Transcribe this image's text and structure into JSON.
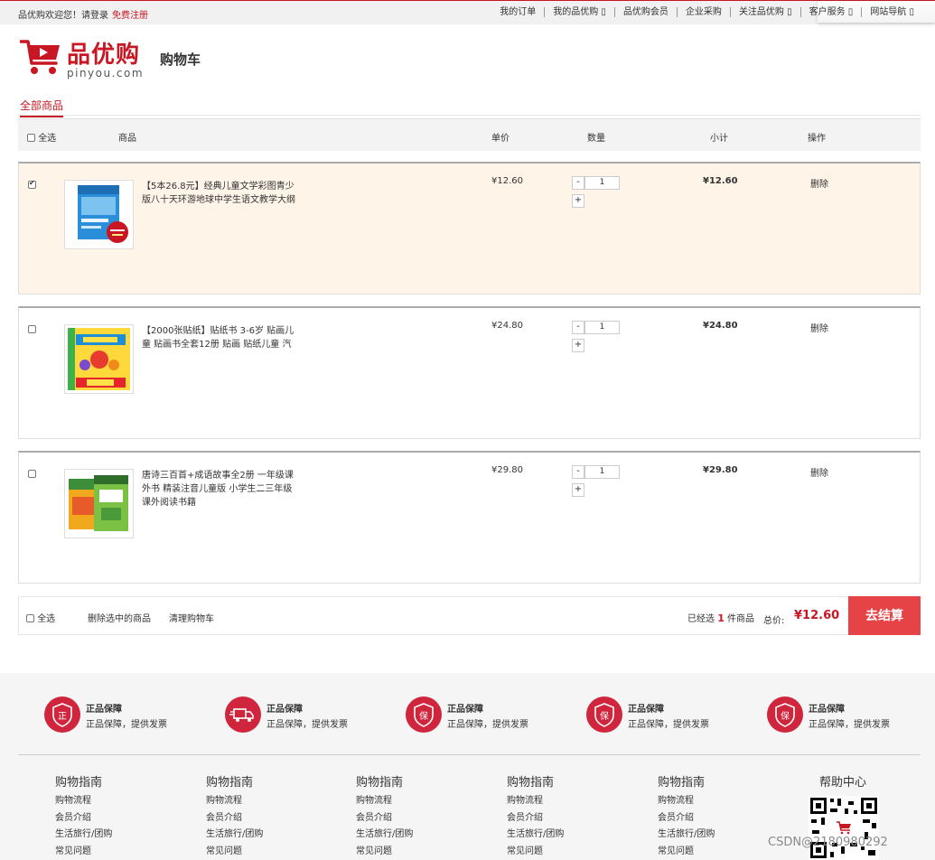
{
  "topbar": {
    "welcome": "品优购欢迎您！请登录",
    "register": "免费注册",
    "nav": [
      "我的订单",
      "我的品优购 ▯",
      "品优购会员",
      "企业采购",
      "关注品优购 ▯",
      "客户服务 ▯",
      "网站导航 ▯"
    ]
  },
  "header": {
    "brand": "品优购",
    "domain": "pinyou.com",
    "page_title": "购物车",
    "cart_icon": "shopping-cart-icon"
  },
  "tabs": {
    "all": "全部商品"
  },
  "table_header": {
    "select_all": "全选",
    "product": "商品",
    "unit_price": "单价",
    "quantity": "数量",
    "subtotal": "小计",
    "action": "操作"
  },
  "items": [
    {
      "checked": true,
      "name": "【5本26.8元】经典儿童文学彩图青少版八十天环游地球中学生语文教学大纲",
      "price": "¥12.60",
      "qty": "1",
      "subtotal": "¥12.60",
      "delete": "删除",
      "minus": "-",
      "plus": "+"
    },
    {
      "checked": false,
      "name": "【2000张贴纸】贴纸书 3-6岁 贴画儿童 贴画书全套12册 贴画 贴纸儿童 汽",
      "price": "¥24.80",
      "qty": "1",
      "subtotal": "¥24.80",
      "delete": "删除",
      "minus": "-",
      "plus": "+"
    },
    {
      "checked": false,
      "name": "唐诗三百首+成语故事全2册 一年级课外书 精装注音儿童版 小学生二三年级课外阅读书籍",
      "price": "¥29.80",
      "qty": "1",
      "subtotal": "¥29.80",
      "delete": "删除",
      "minus": "-",
      "plus": "+"
    }
  ],
  "footbar": {
    "select_all": "全选",
    "delete_selected": "删除选中的商品",
    "clear_cart": "清理购物车",
    "selected_prefix": "已经选",
    "selected_count": "1",
    "selected_suffix": "件商品",
    "total_label": "总价:",
    "total": "¥12.60",
    "checkout": "去结算"
  },
  "promises": [
    {
      "icon": "genuine-icon",
      "glyph": "正",
      "title": "正品保障",
      "desc": "正品保障，提供发票"
    },
    {
      "icon": "delivery-truck-icon",
      "glyph": "🚚",
      "title": "正品保障",
      "desc": "正品保障，提供发票"
    },
    {
      "icon": "guarantee-shield-icon",
      "glyph": "保",
      "title": "正品保障",
      "desc": "正品保障，提供发票"
    },
    {
      "icon": "guarantee-shield-icon",
      "glyph": "保",
      "title": "正品保障",
      "desc": "正品保障，提供发票"
    },
    {
      "icon": "guarantee-shield-icon",
      "glyph": "保",
      "title": "正品保障",
      "desc": "正品保障，提供发票"
    }
  ],
  "footer_cols": [
    {
      "title": "购物指南",
      "items": [
        "购物流程",
        "会员介绍",
        "生活旅行/团购",
        "常见问题"
      ]
    },
    {
      "title": "购物指南",
      "items": [
        "购物流程",
        "会员介绍",
        "生活旅行/团购",
        "常见问题"
      ]
    },
    {
      "title": "购物指南",
      "items": [
        "购物流程",
        "会员介绍",
        "生活旅行/团购",
        "常见问题"
      ]
    },
    {
      "title": "购物指南",
      "items": [
        "购物流程",
        "会员介绍",
        "生活旅行/团购",
        "常见问题"
      ]
    },
    {
      "title": "购物指南",
      "items": [
        "购物流程",
        "会员介绍",
        "生活旅行/团购",
        "常见问题"
      ]
    }
  ],
  "help_center": "帮助中心",
  "watermark": "CSDN@2180980292",
  "colors": {
    "brand_red": "#c81623",
    "checkout_red": "#e54346",
    "selected_row": "#fff4e8"
  }
}
